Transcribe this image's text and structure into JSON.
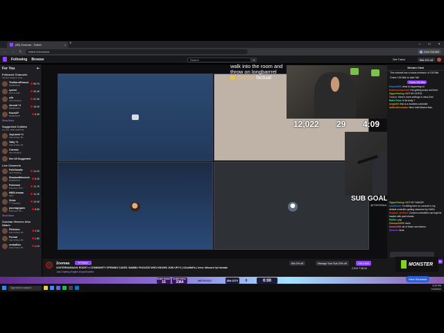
{
  "browser": {
    "tab_title": "(85) Zoomaa - Twitch",
    "tab_close": "×",
    "new_tab": "+",
    "url": "twitch.tv/zoomaa",
    "profile_name": "Josh Gerdell",
    "nav_back": "←",
    "nav_forward": "→",
    "nav_reload": "↻",
    "window_controls": [
      "–",
      "□",
      "×"
    ]
  },
  "twitch_nav": {
    "following": "Following",
    "browse": "Browse",
    "search_placeholder": "Search",
    "search_icon": "⌕",
    "get_turbo": "Get Turbo",
    "bits_label": "Bits 5% off"
  },
  "sidebar": {
    "header": "For You",
    "collapse_icon": "⇤",
    "followed_label": "Followed Channels",
    "followed_sub": "Viewers (High to Low)",
    "followed": [
      {
        "name": "TheBurntPeanut",
        "game": "WARCOGS",
        "viewers": "98.7K"
      },
      {
        "name": "zyoxxi",
        "game": "How to Fish",
        "viewers": "30.4K"
      },
      {
        "name": "x2tr",
        "game": "Just Chatting",
        "viewers": "21.3K"
      },
      {
        "name": "shroud +1",
        "game": "WARCOGS",
        "viewers": "18.4K"
      },
      {
        "name": "HusnAP",
        "game": "WARCOGS",
        "viewers": "6.3K"
      }
    ],
    "show_more": "Show More",
    "suggested_label": "Suggested Collabs",
    "suggested_sub": "For you, while watching",
    "suggested": [
      {
        "name": "JoyLamb +1",
        "game": "Call of Duty: Bl..."
      },
      {
        "name": "Tatty +1",
        "game": "Call of Duty: Bl..."
      },
      {
        "name": "Cozmoz",
        "game": "Just Chatting"
      },
      {
        "name": "See All Suggested",
        "game": ""
      }
    ],
    "live_label": "Live Channels",
    "live": [
      {
        "name": "FaZeSwaite",
        "game": "Just Chatting",
        "viewers": "14.1K"
      },
      {
        "name": "ShadowWimmnie",
        "game": "WARCOGS",
        "viewers": "5.2K"
      },
      {
        "name": "Pokemon",
        "game": "Pokemon TCG",
        "viewers": "11.7K"
      },
      {
        "name": "HBSLiveaaa",
        "game": "Slots",
        "viewers": "11.2K"
      },
      {
        "name": "Zinka",
        "game": "*** Trending",
        "viewers": "10.4K"
      },
      {
        "name": "yourragegam",
        "game": "Pokemon Tra...",
        "viewers": "8.5K"
      }
    ],
    "show_more2": "Show More",
    "also_label": "Zoomaa Viewers Also Watch",
    "also": [
      {
        "name": "FitOnline",
        "game": "Call of Duty: Bl...",
        "viewers": "2.3K"
      },
      {
        "name": "Formal",
        "game": "Call of Duty: Bl...",
        "viewers": "1.8K"
      },
      {
        "name": "zenbaBxo",
        "game": "Call of Duty: Bl...",
        "viewers": "1.1K"
      }
    ]
  },
  "overlay_msg": {
    "text": "walk into the room and throw on longbarrrel",
    "user": "Qzcepo",
    "tail": "factual"
  },
  "cam_stats": {
    "kills": "12,022",
    "streak": "29",
    "time": "4:09"
  },
  "subgoal": {
    "text": "SUB GOAL: 3364 / 3700",
    "handle": "@THEZMAA"
  },
  "chat": {
    "header": "Stream Chat",
    "notice": "This channel has a chaos minimum of 100 Bits",
    "cheer_prefix": "Cheer",
    "cheer_amount": "100",
    "cheer_suffix": "Bits to take Tali",
    "cheer_button": "Cheer 100 Bits",
    "top_messages": [
      {
        "user": "Riwarolt05",
        "color": "#1e90ff",
        "text": "what is happening lol"
      },
      {
        "user": "thabensonquerad",
        "color": "#ff4500",
        "text": "Hrs getting scary out there"
      },
      {
        "user": "ZipperPacing",
        "color": "#9acd32",
        "text": "NOT MY MTRO"
      },
      {
        "user": "Tarbyo",
        "color": "#ff69b4",
        "text": "there's more settings in mica-Drei"
      },
      {
        "user": "BallerTuba",
        "color": "#00ff7f",
        "text": "hi its trully ?"
      },
      {
        "user": "nmgls03",
        "color": "#daa520",
        "text": "this is a mocktes controller"
      },
      {
        "user": "kallendercoonks",
        "color": "#ff8c00",
        "text": "bbox Intel Marion than"
      }
    ],
    "bottom_messages": [
      {
        "user": "ZipperPacing",
        "color": "#9acd32",
        "text": "NOT MY SAMOR"
      },
      {
        "user": "cazelthem",
        "color": "#1e90ff",
        "text": "I'm sitting here on console w my default controller getting slammed by HASA"
      },
      {
        "user": "Ampool_simBoo",
        "color": "#ff4500",
        "text": "Custom controllers can legit be loaded with paid cheats"
      },
      {
        "user": "PaiSin",
        "color": "#00ff7f",
        "text": "yup"
      },
      {
        "user": "Zimmani9999",
        "color": "#daa520",
        "text": "facts"
      },
      {
        "user": "Imnot1498",
        "color": "#ff69b4",
        "text": "all of these use Marion"
      },
      {
        "user": "Mazinlo",
        "color": "#9146ff",
        "text": "facts"
      }
    ],
    "chat_button": "Chat"
  },
  "monster": {
    "brand": "MONSTER",
    "sub": "ENERGY"
  },
  "infobar": {
    "streamer": "Zoomaa",
    "follow": "♥ Follow",
    "title": "#OSTERNAMAA01 RCKHT x COMMUNITY OPENING CASES. BAMBU FUGAZZ0 WHO KNOWS JOIN UP!!!! | #ZoeMaFa | !reno !discord !yt !donate",
    "game": "Just Chatting  English  DropsEnabled",
    "bits_btn": "Bits 5% off",
    "manage_sub": "Manage Your Sub 20% off",
    "gift_sub": "Gift a Sub",
    "viewers": "2,919  7:38:24"
  },
  "gamebar": {
    "subs_today_label": "SUBS TODAY",
    "subs_today": "15",
    "subs_total_label": "SUBS TOTAL",
    "subs_total": "3364",
    "methodz": "METHODZ",
    "zin": "ZIN CITY",
    "timer": "0:00",
    "score": "0",
    "schedule_btn": "View Schedule"
  },
  "taskbar": {
    "search_placeholder": "Type here to search",
    "tray_time": "9:29 PM",
    "tray_date": "7/15/2024"
  },
  "colors": {
    "twitch_purple": "#9146ff",
    "live_red": "#eb0400",
    "bg_dark": "#18181b"
  }
}
